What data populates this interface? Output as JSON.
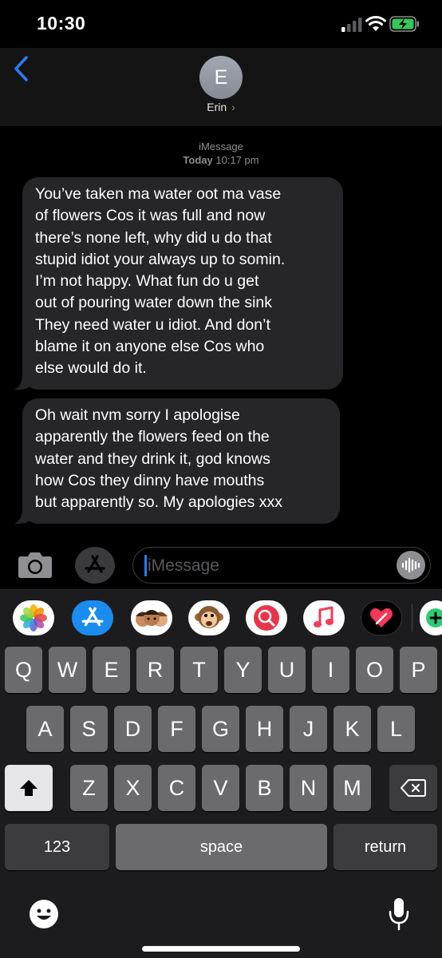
{
  "status_bar": {
    "time": "10:30"
  },
  "header": {
    "avatar_initial": "E",
    "contact_name": "Erin",
    "contact_chevron": "›"
  },
  "conversation": {
    "service": "iMessage",
    "date": "Today",
    "time": "10:17 pm",
    "messages": [
      {
        "lines": [
          "You’ve taken ma water oot ma vase",
          "of flowers Cos it was full and now",
          "there’s none left, why did u do that",
          "stupid idiot your always up to somin.",
          "I’m not happy. What fun do u get",
          "out of pouring water down the sink",
          "They need water u idiot. And don’t",
          "blame it on anyone else Cos who",
          "else would do it."
        ]
      },
      {
        "lines": [
          "Oh wait nvm sorry I apologise",
          "apparently the flowers feed on the",
          "water and they drink it, god knows",
          "how Cos they dinny have mouths",
          "but apparently so. My apologies xxx"
        ]
      }
    ]
  },
  "input": {
    "placeholder": "iMessage"
  },
  "app_drawer": [
    "photos-icon",
    "app-store-icon",
    "memoji-icon",
    "animoji-icon",
    "web-search-icon",
    "music-icon",
    "digital-touch-icon",
    "more-apps-icon"
  ],
  "keyboard": {
    "row1": [
      "Q",
      "W",
      "E",
      "R",
      "T",
      "Y",
      "U",
      "I",
      "O",
      "P"
    ],
    "row2": [
      "A",
      "S",
      "D",
      "F",
      "G",
      "H",
      "J",
      "K",
      "L"
    ],
    "row3": [
      "Z",
      "X",
      "C",
      "V",
      "B",
      "N",
      "M"
    ],
    "numbers": "123",
    "space": "space",
    "return": "return"
  },
  "colors": {
    "accent": "#2b7cf6",
    "bubble": "#262628",
    "keyboard_bg": "#1c1c1e",
    "key": "#6b6b6e"
  }
}
